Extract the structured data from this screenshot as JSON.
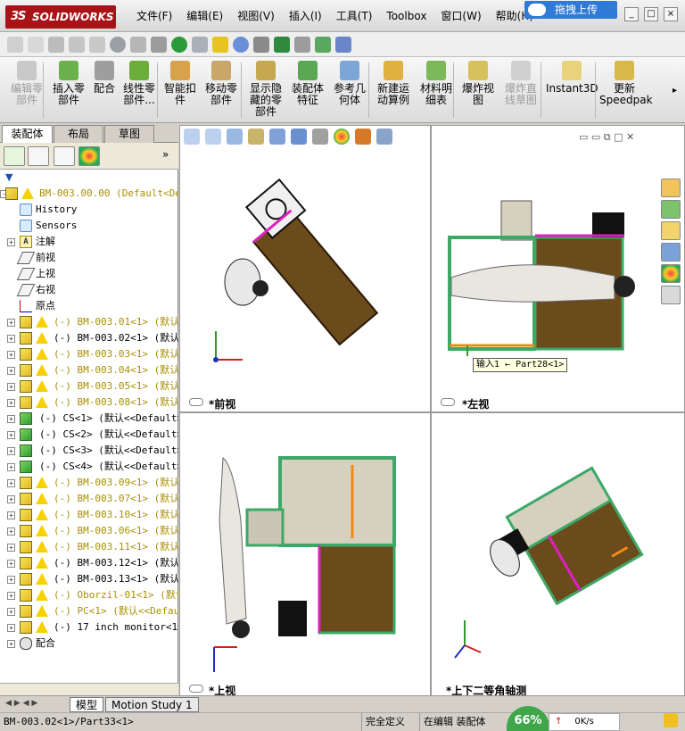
{
  "app": {
    "logo": "SOLIDWORKS",
    "logo_prefix": "3S"
  },
  "menu": [
    "文件(F)",
    "编辑(E)",
    "视图(V)",
    "插入(I)",
    "工具(T)",
    "Toolbox",
    "窗口(W)",
    "帮助(H)"
  ],
  "upload_button": "拖拽上传",
  "commands": [
    {
      "label": "编辑零\n部件",
      "disabled": true
    },
    {
      "label": "插入零\n部件",
      "disabled": false
    },
    {
      "label": "配合",
      "disabled": false
    },
    {
      "label": "线性零\n部件...",
      "disabled": false
    },
    {
      "label": "智能扣\n件",
      "disabled": false
    },
    {
      "label": "移动零\n部件",
      "disabled": false
    },
    {
      "label": "显示隐\n藏的零\n部件",
      "disabled": false
    },
    {
      "label": "装配体\n特征",
      "disabled": false
    },
    {
      "label": "参考几\n何体",
      "disabled": false
    },
    {
      "label": "新建运\n动算例",
      "disabled": false
    },
    {
      "label": "材料明\n细表",
      "disabled": false
    },
    {
      "label": "爆炸视\n图",
      "disabled": false
    },
    {
      "label": "爆炸直\n线草图",
      "disabled": true
    },
    {
      "label": "Instant3D",
      "disabled": false
    },
    {
      "label": "更新\nSpeedpak",
      "disabled": false
    }
  ],
  "left_tabs": [
    "装配体",
    "布局",
    "草图"
  ],
  "tree": [
    {
      "text": "BM-003.00.00  (Default<Def",
      "icon": "cube-warn",
      "indent": 0,
      "color": "yellow",
      "expand": "-"
    },
    {
      "text": "History",
      "icon": "history",
      "indent": 1,
      "color": "black",
      "expand": ""
    },
    {
      "text": "Sensors",
      "icon": "sensor",
      "indent": 1,
      "color": "black",
      "expand": ""
    },
    {
      "text": "注解",
      "icon": "note",
      "indent": 1,
      "color": "black",
      "expand": "+"
    },
    {
      "text": "前视",
      "icon": "plane",
      "indent": 1,
      "color": "black",
      "expand": ""
    },
    {
      "text": "上视",
      "icon": "plane",
      "indent": 1,
      "color": "black",
      "expand": ""
    },
    {
      "text": "右视",
      "icon": "plane",
      "indent": 1,
      "color": "black",
      "expand": ""
    },
    {
      "text": "原点",
      "icon": "origin",
      "indent": 1,
      "color": "black",
      "expand": ""
    },
    {
      "text": "(-) BM-003.01<1> (默认<",
      "icon": "cube-warn",
      "indent": 1,
      "color": "yellow",
      "expand": "+"
    },
    {
      "text": "(-) BM-003.02<1> (默认<Def",
      "icon": "cube-warn",
      "indent": 1,
      "color": "black",
      "expand": "+"
    },
    {
      "text": "(-) BM-003.03<1> (默认<",
      "icon": "cube-warn",
      "indent": 1,
      "color": "yellow",
      "expand": "+"
    },
    {
      "text": "(-) BM-003.04<1> (默认<",
      "icon": "cube-warn",
      "indent": 1,
      "color": "yellow",
      "expand": "+"
    },
    {
      "text": "(-) BM-003.05<1> (默认<",
      "icon": "cube-warn",
      "indent": 1,
      "color": "yellow",
      "expand": "+"
    },
    {
      "text": "(-) BM-003.08<1> (默认<",
      "icon": "cube-warn",
      "indent": 1,
      "color": "yellow",
      "expand": "+"
    },
    {
      "text": "(-) CS<1> (默认<<Default>_",
      "icon": "cube-g",
      "indent": 1,
      "color": "black",
      "expand": "+"
    },
    {
      "text": "(-) CS<2> (默认<<Default>_",
      "icon": "cube-g",
      "indent": 1,
      "color": "black",
      "expand": "+"
    },
    {
      "text": "(-) CS<3> (默认<<Default>_",
      "icon": "cube-g",
      "indent": 1,
      "color": "black",
      "expand": "+"
    },
    {
      "text": "(-) CS<4> (默认<<Default>_",
      "icon": "cube-g",
      "indent": 1,
      "color": "black",
      "expand": "+"
    },
    {
      "text": "(-) BM-003.09<1> (默认<",
      "icon": "cube-warn",
      "indent": 1,
      "color": "yellow",
      "expand": "+"
    },
    {
      "text": "(-) BM-003.07<1> (默认<",
      "icon": "cube-warn",
      "indent": 1,
      "color": "yellow",
      "expand": "+"
    },
    {
      "text": "(-) BM-003.10<1> (默认<",
      "icon": "cube-warn",
      "indent": 1,
      "color": "yellow",
      "expand": "+"
    },
    {
      "text": "(-) BM-003.06<1> (默认<",
      "icon": "cube-warn",
      "indent": 1,
      "color": "yellow",
      "expand": "+"
    },
    {
      "text": "(-) BM-003.11<1> (默认<",
      "icon": "cube-warn",
      "indent": 1,
      "color": "yellow",
      "expand": "+"
    },
    {
      "text": "(-) BM-003.12<1> (默认<Def",
      "icon": "cube-warn",
      "indent": 1,
      "color": "black",
      "expand": "+"
    },
    {
      "text": "(-) BM-003.13<1> (默认<De",
      "icon": "cube-warn",
      "indent": 1,
      "color": "black",
      "expand": "+"
    },
    {
      "text": "(-) Oborzil-01<1> (默认<",
      "icon": "cube-warn",
      "indent": 1,
      "color": "yellow",
      "expand": "+"
    },
    {
      "text": "(-) PC<1> (默认<<Defaul",
      "icon": "cube-warn",
      "indent": 1,
      "color": "yellow",
      "expand": "+"
    },
    {
      "text": "(-) 17 inch monitor<1> (默",
      "icon": "cube-warn",
      "indent": 1,
      "color": "black",
      "expand": "+"
    },
    {
      "text": "配合",
      "icon": "mate",
      "indent": 1,
      "color": "black",
      "expand": "+"
    }
  ],
  "viewports": {
    "front": "*前视",
    "left": "*左视",
    "top": "*上视",
    "iso": "*上下二等角轴测"
  },
  "tooltip": "输入1 ← Part28<1>",
  "bottom_tabs": [
    "模型",
    "Motion Study 1"
  ],
  "status": {
    "path": "BM-003.02<1>/Part33<1>",
    "defined": "完全定义",
    "editing": "在编辑 装配体",
    "gauge": "66%",
    "net": "0K/s"
  },
  "colors": {
    "wood": "#6b4a1c",
    "frame": "#3ea866",
    "accent_pink": "#e020c0",
    "orange": "#f08a10"
  }
}
